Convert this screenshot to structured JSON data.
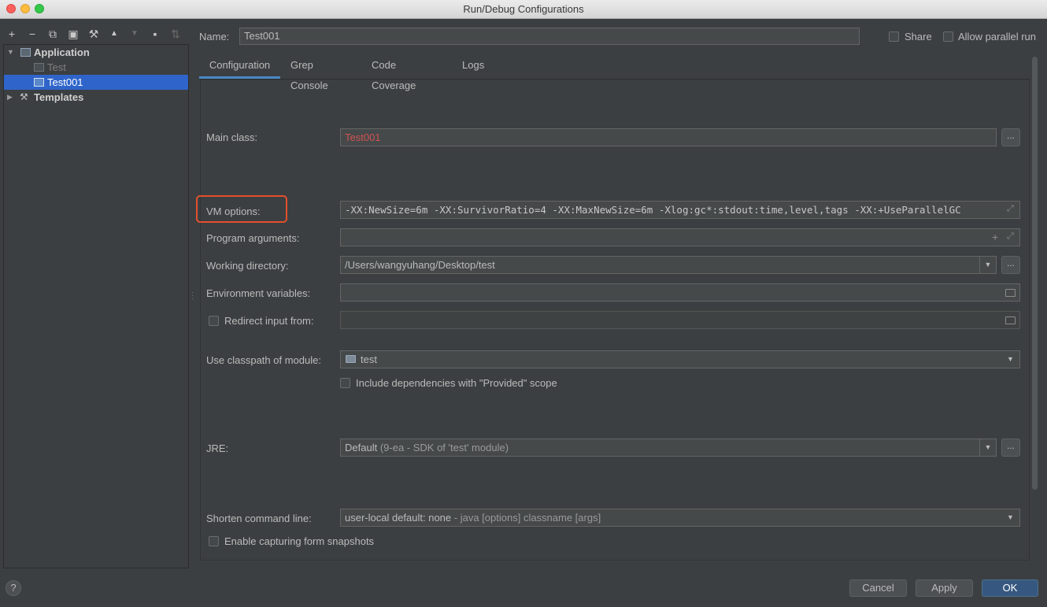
{
  "window": {
    "title": "Run/Debug Configurations"
  },
  "toolbar": {
    "icons": [
      "add-icon",
      "remove-icon",
      "copy-icon",
      "save-icon",
      "wrench-icon",
      "move-up-icon",
      "move-down-icon",
      "new-folder-icon",
      "sort-icon"
    ],
    "glyphs": [
      "+",
      "−",
      "⧉",
      "▣",
      "⚒",
      "▲",
      "▼",
      "▪",
      "⇅"
    ]
  },
  "tree": {
    "application": "Application",
    "test": "Test",
    "test001": "Test001",
    "templates": "Templates"
  },
  "header": {
    "name_label": "Name:",
    "name_value": "Test001",
    "share_label": "Share",
    "allow_parallel_label": "Allow parallel run"
  },
  "tabs": [
    "Configuration",
    "Grep Console",
    "Code Coverage",
    "Logs"
  ],
  "form": {
    "main_class_label": "Main class:",
    "main_class_value": "Test001",
    "vm_options_label": "VM options:",
    "vm_options_value": "-XX:NewSize=6m -XX:SurvivorRatio=4 -XX:MaxNewSize=6m -Xlog:gc*:stdout:time,level,tags -XX:+UseParallelGC",
    "program_args_label": "Program arguments:",
    "program_args_value": "",
    "working_dir_label": "Working directory:",
    "working_dir_value": "/Users/wangyuhang/Desktop/test",
    "env_vars_label": "Environment variables:",
    "env_vars_value": "",
    "redirect_label": "Redirect input from:",
    "classpath_label": "Use classpath of module:",
    "classpath_value": "test",
    "include_deps_label": "Include dependencies with \"Provided\" scope",
    "jre_label": "JRE:",
    "jre_main": "Default",
    "jre_detail": "(9-ea - SDK of 'test' module)",
    "shorten_label": "Shorten command line:",
    "shorten_main": "user-local default: none",
    "shorten_detail": "- java [options] classname [args]",
    "capture_label": "Enable capturing form snapshots",
    "dots": "..."
  },
  "footer": {
    "help": "?",
    "cancel": "Cancel",
    "apply": "Apply",
    "ok": "OK"
  },
  "colors": {
    "accent": "#2f65ca",
    "error_text": "#d25252",
    "highlight_box": "#e2502c",
    "tab_underline": "#4a88c7"
  }
}
